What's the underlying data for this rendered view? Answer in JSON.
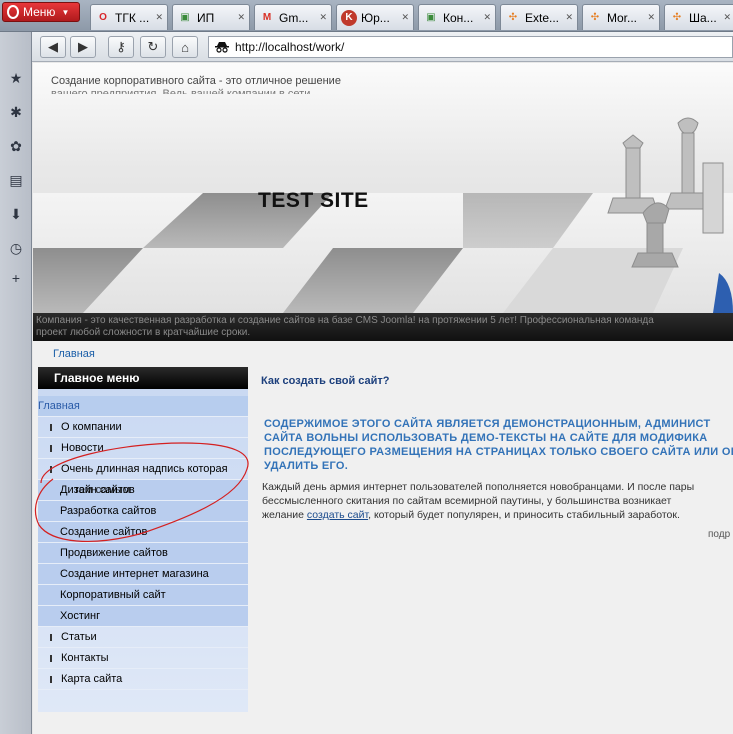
{
  "browser": {
    "menu_label": "Меню",
    "tabs": [
      {
        "label": "ТГК ...",
        "icon": "opera-icon",
        "color": "#d8262b"
      },
      {
        "label": "ИП",
        "icon": "page-icon",
        "color": "#3a8a3a"
      },
      {
        "label": "Gm...",
        "icon": "gmail-icon",
        "color": "#d93025"
      },
      {
        "label": "Юр...",
        "icon": "k-icon",
        "color": "#c0392b"
      },
      {
        "label": "Кон...",
        "icon": "page-icon",
        "color": "#3a8a3a"
      },
      {
        "label": "Exte...",
        "icon": "joomla-icon",
        "color": "#e67e22"
      },
      {
        "label": "Mor...",
        "icon": "joomla-icon",
        "color": "#e67e22"
      },
      {
        "label": "Ша...",
        "icon": "joomla-icon",
        "color": "#e67e22"
      }
    ],
    "url": "http://localhost/work/"
  },
  "site": {
    "slogan": "Создание корпоративного сайта - это отличное решение",
    "slogan2": "вашего предприятия. Ведь вашей компании в сети",
    "title": "TEST SITE",
    "band_line1": "Компания - это качественная разработка и создание сайтов на базе CMS Joomla! на протяжении 5 лет! Профессиональная команда",
    "band_line2": "проект любой сложности в кратчайшие сроки.",
    "breadcrumb": "Главная"
  },
  "menu": {
    "heading": "Главное меню",
    "items": [
      {
        "label": "Главная",
        "level": "active"
      },
      {
        "label": "О компании",
        "level": "l1"
      },
      {
        "label": "Новости",
        "level": "l1"
      },
      {
        "label": "Очень длинная надпись которая",
        "level": "l1"
      },
      {
        "label": "Дизайн сайтов",
        "level": "l2"
      },
      {
        "label": "Разработка сайтов",
        "level": "l2"
      },
      {
        "label": "Создание сайтов",
        "level": "l2"
      },
      {
        "label": "Продвижение сайтов",
        "level": "l2"
      },
      {
        "label": "Создание интернет магазина",
        "level": "l2"
      },
      {
        "label": "Корпоративный сайт",
        "level": "l2"
      },
      {
        "label": "Хостинг",
        "level": "l2"
      },
      {
        "label": "Статьи",
        "level": "l1"
      },
      {
        "label": "Контакты",
        "level": "l1"
      },
      {
        "label": "Карта сайта",
        "level": "l1"
      }
    ],
    "overflow_text": "тем самым"
  },
  "article": {
    "title": "Как создать свой сайт?",
    "upper_lines": [
      "СОДЕРЖИМОЕ ЭТОГО САЙТА ЯВЛЯЕТСЯ ДЕМОНСТРАЦИОННЫМ, АДМИНИСТ",
      "САЙТА ВОЛЬНЫ ИСПОЛЬЗОВАТЬ ДЕМО-ТЕКСТЫ НА САЙТЕ ДЛЯ МОДИФИКА",
      "ПОСЛЕДУЮЩЕГО РАЗМЕЩЕНИЯ НА СТРАНИЦАХ ТОЛЬКО СВОЕГО САЙТА ИЛИ ОБ",
      "УДАЛИТЬ ЕГО."
    ],
    "body_line1": "Каждый день армия интернет пользователей пополняется новобранцами. И после пары",
    "body_line2": "бессмысленного скитания по сайтам всемирной паутины, у большинства возникает",
    "body_line3_pre": "желание ",
    "body_link": "создать сайт",
    "body_line3_post": ", который будет популярен, и приносить стабильный заработок.",
    "readmore": "подр"
  },
  "colors": {
    "annotation": "#d42020",
    "link": "#1a5ea8",
    "heading_blue": "#3373b8"
  }
}
